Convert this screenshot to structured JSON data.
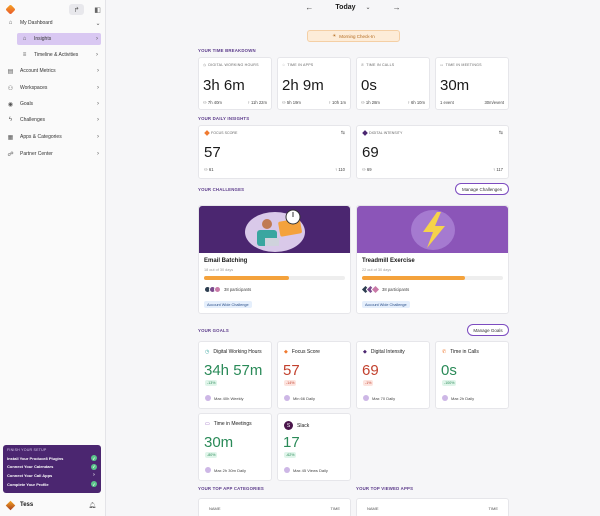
{
  "app": {
    "user": "Tess"
  },
  "sidebar": {
    "items": [
      {
        "label": "My Dashboard",
        "icon": "dashboard-icon"
      },
      {
        "label": "Insights",
        "icon": "home-icon"
      },
      {
        "label": "Timeline & Activities",
        "icon": "timeline-icon"
      },
      {
        "label": "Account Metrics",
        "icon": "chart-icon"
      },
      {
        "label": "Workspaces",
        "icon": "users-icon"
      },
      {
        "label": "Goals",
        "icon": "target-icon"
      },
      {
        "label": "Challenges",
        "icon": "bolt-icon"
      },
      {
        "label": "Apps & Categories",
        "icon": "grid-icon"
      },
      {
        "label": "Partner Center",
        "icon": "handshake-icon"
      }
    ]
  },
  "setup": {
    "heading": "FINISH YOUR SETUP",
    "items": [
      "Install Your Produce8 Plugins",
      "Connect Your Calendars",
      "Connect Your Call Apps",
      "Complete Your Profile"
    ]
  },
  "header": {
    "day": "Today"
  },
  "checkin": "Morning Check-In",
  "time_breakdown": {
    "title": "YOUR TIME BREAKDOWN",
    "cards": [
      {
        "label": "DIGITAL WORKING HOURS",
        "value": "3h 6m",
        "left": "7h 40m",
        "right": "11h 22m"
      },
      {
        "label": "TIME IN APPS",
        "value": "2h 9m",
        "left": "5h 19m",
        "right": "10h 1m"
      },
      {
        "label": "TIME IN CALLS",
        "value": "0s",
        "left": "1h 28m",
        "right": "6h 10m"
      },
      {
        "label": "TIME IN MEETINGS",
        "value": "30m",
        "left": "1 event",
        "right": "30m/event"
      }
    ]
  },
  "daily_insights": {
    "title": "YOUR DAILY INSIGHTS",
    "cards": [
      {
        "label": "FOCUS SCORE",
        "value": "57",
        "left": "61",
        "right": "110",
        "color": "#f07a30"
      },
      {
        "label": "DIGITAL INTENSITY",
        "value": "69",
        "left": "69",
        "right": "117",
        "color": "#4b2670"
      }
    ]
  },
  "challenges": {
    "title": "YOUR CHALLENGES",
    "button": "Manage Challenges",
    "items": [
      {
        "name": "Email Batching",
        "sub": "18 out of 30 days",
        "progress": 0.6,
        "participants": "38 participants",
        "tag": "Account Wide Challenge"
      },
      {
        "name": "Treadmill Exercise",
        "sub": "22 out of 30 days",
        "progress": 0.73,
        "participants": "38 participants",
        "tag": "Account Wide Challenge"
      }
    ]
  },
  "goals": {
    "title": "YOUR GOALS",
    "button": "Manage Goals",
    "items": [
      {
        "name": "Digital Working Hours",
        "value": "34h 57m",
        "pct": "-13%",
        "target": "Max 40h Weekly",
        "color": "#2a8a58",
        "kind": "pos"
      },
      {
        "name": "Focus Score",
        "value": "57",
        "pct": "-14%",
        "target": "Min 66 Daily",
        "color": "#c2412e",
        "kind": "neg"
      },
      {
        "name": "Digital Intensity",
        "value": "69",
        "pct": "-1%",
        "target": "Max 70 Daily",
        "color": "#c2412e",
        "kind": "neg"
      },
      {
        "name": "Time in Calls",
        "value": "0s",
        "pct": "-100%",
        "target": "Max 2h Daily",
        "color": "#2a8a58",
        "kind": "pos"
      },
      {
        "name": "Time in Meetings",
        "value": "30m",
        "pct": "-80%",
        "target": "Max 2h 30m Daily",
        "color": "#2a8a58",
        "kind": "pos"
      },
      {
        "name": "Slack",
        "value": "17",
        "pct": "-62%",
        "target": "Max 45 Views Daily",
        "color": "#2a8a58",
        "kind": "pos"
      }
    ]
  },
  "top_apps": {
    "cat_title": "YOUR TOP APP CATEGORIES",
    "viewed_title": "YOUR TOP VIEWED APPS",
    "col_name": "NAME",
    "col_time": "TIME"
  }
}
